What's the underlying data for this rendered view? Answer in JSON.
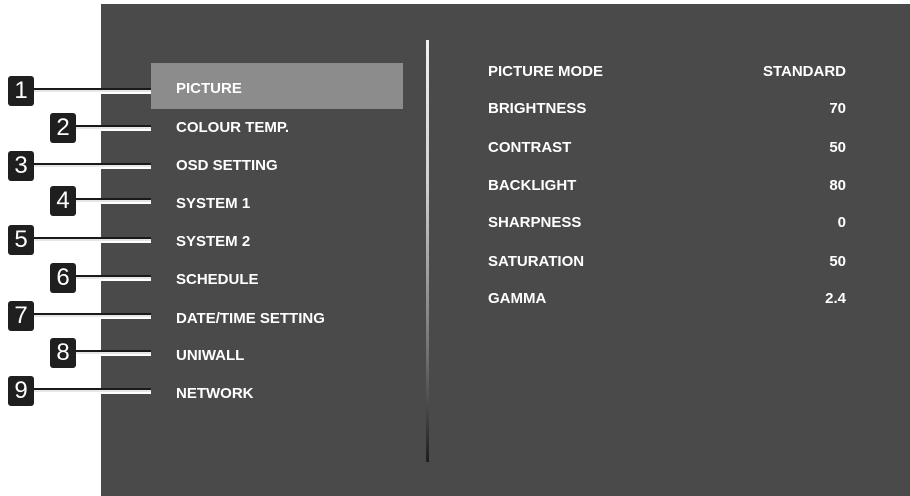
{
  "menu": {
    "items": [
      {
        "number": "1",
        "label": "PICTURE",
        "selected": true
      },
      {
        "number": "2",
        "label": "COLOUR TEMP."
      },
      {
        "number": "3",
        "label": "OSD SETTING"
      },
      {
        "number": "4",
        "label": "SYSTEM 1"
      },
      {
        "number": "5",
        "label": "SYSTEM 2"
      },
      {
        "number": "6",
        "label": "SCHEDULE"
      },
      {
        "number": "7",
        "label": "DATE/TIME SETTING"
      },
      {
        "number": "8",
        "label": "UNIWALL"
      },
      {
        "number": "9",
        "label": "NETWORK"
      }
    ]
  },
  "settings": {
    "rows": [
      {
        "label": "PICTURE MODE",
        "value": "STANDARD"
      },
      {
        "label": "BRIGHTNESS",
        "value": "70"
      },
      {
        "label": "CONTRAST",
        "value": "50"
      },
      {
        "label": "BACKLIGHT",
        "value": "80"
      },
      {
        "label": "SHARPNESS",
        "value": "0"
      },
      {
        "label": "SATURATION",
        "value": "50"
      },
      {
        "label": "GAMMA",
        "value": "2.4"
      }
    ]
  },
  "colors": {
    "panel_background": "#4a4a4a",
    "selected_background": "#8c8c8c",
    "text": "#ffffff",
    "callout_badge": "#1f1f1f"
  }
}
